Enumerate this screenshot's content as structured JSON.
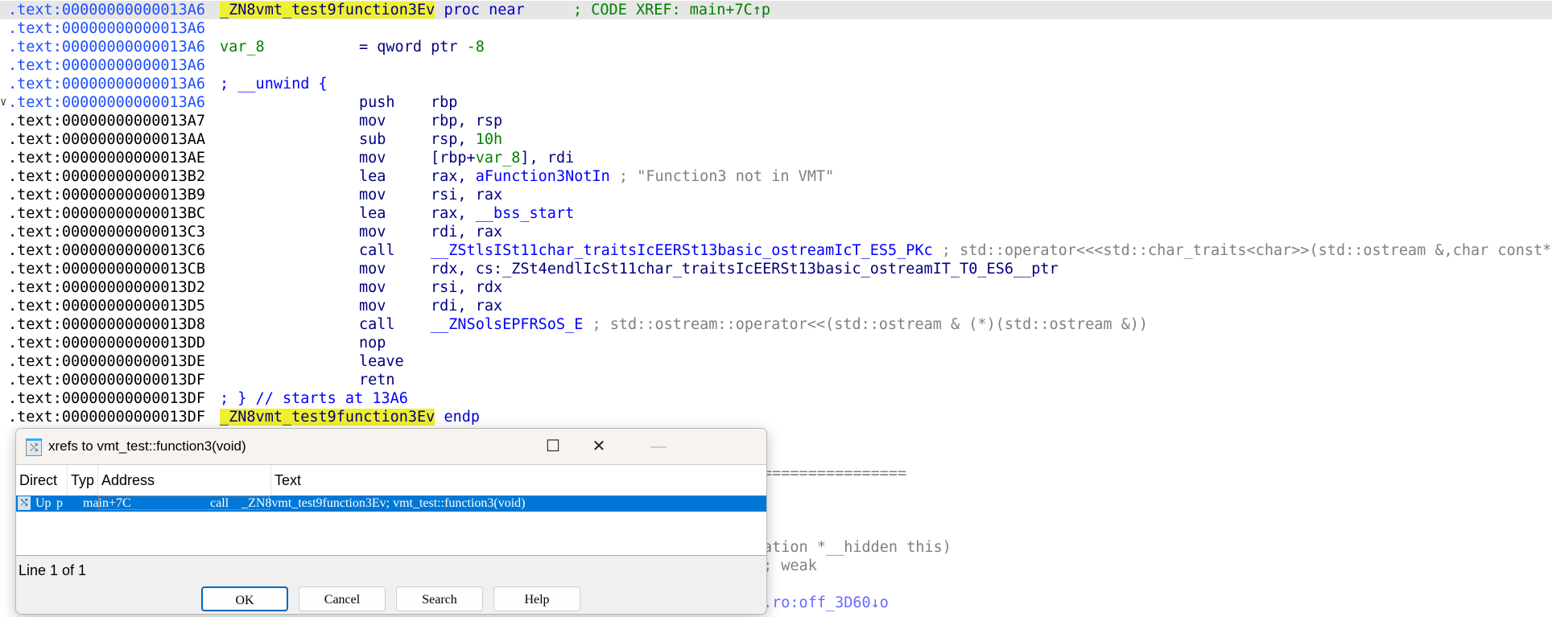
{
  "listing": {
    "rows": [
      {
        "addr": ".text:00000000000013A6",
        "label": "_ZN8vmt_test9function3Ev",
        "rest": " proc near",
        "comment": "; CODE XREF: main+7C↑p"
      },
      {
        "addr": ".text:00000000000013A6"
      },
      {
        "addr": ".text:00000000000013A6",
        "label": "var_8",
        "decl": "= qword ptr ",
        "decl_val": "-8"
      },
      {
        "addr": ".text:00000000000013A6"
      },
      {
        "addr": ".text:00000000000013A6",
        "label": "; __unwind {"
      },
      {
        "addr": ".text:00000000000013A6",
        "mn": "push",
        "ops": "rbp",
        "chevron": "∨"
      },
      {
        "addr": ".text:00000000000013A7",
        "mn": "mov",
        "ops": "rbp, rsp"
      },
      {
        "addr": ".text:00000000000013AA",
        "mn": "sub",
        "ops": "rsp, ",
        "ops_num": "10h"
      },
      {
        "addr": ".text:00000000000013AE",
        "mn": "mov",
        "ops": "[rbp+",
        "ops_var": "var_8",
        "ops_tail": "], rdi"
      },
      {
        "addr": ".text:00000000000013B2",
        "mn": "lea",
        "ops": "rax, ",
        "ops_name": "aFunction3NotIn",
        "comment": " ; \"Function3 not in VMT\""
      },
      {
        "addr": ".text:00000000000013B9",
        "mn": "mov",
        "ops": "rsi, rax"
      },
      {
        "addr": ".text:00000000000013BC",
        "mn": "lea",
        "ops": "rax, ",
        "ops_name": "__bss_start"
      },
      {
        "addr": ".text:00000000000013C3",
        "mn": "mov",
        "ops": "rdi, rax"
      },
      {
        "addr": ".text:00000000000013C6",
        "mn": "call",
        "ops": "",
        "ops_name": "__ZStlsISt11char_traitsIcEERSt13basic_ostreamIcT_ES5_PKc",
        "comment": " ; std::operator<<<std::char_traits<char>>(std::ostream &,char const*)"
      },
      {
        "addr": ".text:00000000000013CB",
        "mn": "mov",
        "ops": "rdx, cs:_ZSt4endlIcSt11char_traitsIcEERSt13basic_ostreamIT_T0_ES6__ptr"
      },
      {
        "addr": ".text:00000000000013D2",
        "mn": "mov",
        "ops": "rsi, rdx"
      },
      {
        "addr": ".text:00000000000013D5",
        "mn": "mov",
        "ops": "rdi, rax"
      },
      {
        "addr": ".text:00000000000013D8",
        "mn": "call",
        "ops": "",
        "ops_name": "__ZNSolsEPFRSoS_E",
        "comment": " ; std::ostream::operator<<(std::ostream & (*)(std::ostream &))"
      },
      {
        "addr": ".text:00000000000013DD",
        "mn": "nop"
      },
      {
        "addr": ".text:00000000000013DE",
        "mn": "leave"
      },
      {
        "addr": ".text:00000000000013DF",
        "mn": "retn"
      },
      {
        "addr": ".text:00000000000013DF",
        "label": "; } // starts at 13A6"
      },
      {
        "addr": ".text:00000000000013DF",
        "label": "_ZN8vmt_test9function3Ev",
        "rest": " endp"
      }
    ],
    "behind": {
      "separator": "================",
      "hidden_this": "ation *__hidden this)",
      "weak": "; weak",
      "xref": ".ro:off_3D60↓o"
    }
  },
  "dialog": {
    "title": "xrefs to vmt_test::function3(void)",
    "controls": {
      "minimize": "—",
      "maximize": "☐",
      "close": "✕"
    },
    "columns": [
      "Direct",
      "Typ",
      "Address",
      "Text"
    ],
    "rows": [
      {
        "direction": "Up",
        "type": "p",
        "address": "main+7C",
        "text": "call    _ZN8vmt_test9function3Ev; vmt_test::function3(void)"
      }
    ],
    "status": "Line 1 of 1",
    "buttons": {
      "ok": "OK",
      "cancel": "Cancel",
      "search": "Search",
      "help": "Help"
    }
  }
}
